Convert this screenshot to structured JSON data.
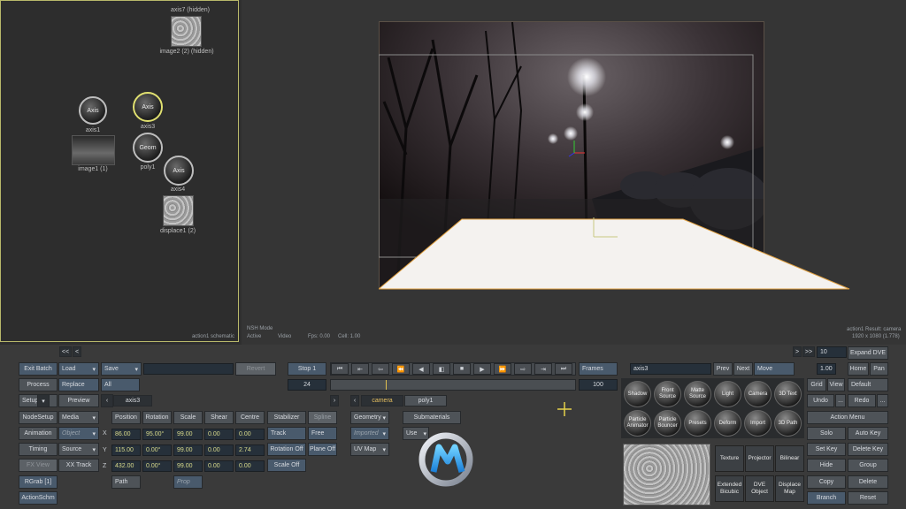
{
  "schematic": {
    "nodes": {
      "axis7_label": "axis7 (hidden)",
      "image2_label": "image2 (2) (hidden)",
      "axis1_ball": "Axis",
      "axis1_label": "axis1",
      "axis3_ball": "Axis",
      "axis3_label": "axis3",
      "image1_label": "image1 (1)",
      "geom_ball": "Geom",
      "poly1_label": "poly1",
      "axis4_ball": "Axis",
      "axis4_label": "axis4",
      "displace1_label": "displace1 (2)"
    },
    "status": "action1 schematic"
  },
  "viewport": {
    "info_top": "action1 Result: camera",
    "info_res": "1920 x 1080 (1.778)",
    "mode": "NSH Mode",
    "active": "Active",
    "video": "Video",
    "fps": "Fps: 0.00",
    "cell": "Cell: 1.00"
  },
  "toolbar": {
    "nav_left": "<<",
    "nav_left2": "<",
    "nav_right": ">",
    "nav_right2": ">>",
    "frame_field": "10",
    "expand": "Expand DVE",
    "scale_field": "1.00",
    "home": "Home",
    "pan": "Pan"
  },
  "left_buttons": {
    "exit": "Exit Batch",
    "load": "Load",
    "save": "Save",
    "revert": "Revert",
    "process": "Process",
    "replace": "Replace",
    "all": "All",
    "setup": "Setup",
    "preview": "Preview",
    "nodesetup": "NodeSetup",
    "media": "Media",
    "animation": "Animation",
    "object": "Object",
    "timing": "Timing",
    "source": "Source",
    "fx_view": "FX View",
    "xx_track": "XX Track",
    "rgrab": "RGrab [1]",
    "action_schm": "ActionSchm"
  },
  "transport": {
    "stop": "Stop 1",
    "frame": "24",
    "frames_label": "Frames",
    "end_frame": "100"
  },
  "tabs": {
    "axis_tab": "axis3",
    "camera_tab": "camera",
    "poly_tab": "poly1"
  },
  "transform": {
    "headers": [
      "Position",
      "Rotation",
      "Scale",
      "Shear",
      "Centre"
    ],
    "stabilizer": "Stabilizer",
    "spline": "Spline",
    "rows": [
      {
        "axis": "X",
        "pos": "86.00",
        "rot": "95.00°",
        "scale": "99.00",
        "shear": "0.00",
        "centre": "0.00"
      },
      {
        "axis": "Y",
        "pos": "115.00",
        "rot": "0.00°",
        "scale": "99.00",
        "shear": "0.00",
        "centre": "2.74"
      },
      {
        "axis": "Z",
        "pos": "432.00",
        "rot": "0.00°",
        "scale": "99.00",
        "shear": "0.00",
        "centre": "0.00"
      }
    ],
    "track": "Track",
    "free": "Free",
    "rotation_off": "Rotation Off",
    "plane_off": "Plane Off",
    "scale_off": "Scale Off",
    "path": "Path",
    "prop": "Prop"
  },
  "geometry": {
    "geometry": "Geometry",
    "imported": "Imported",
    "uv_map": "UV Map",
    "submaterials": "Submaterials",
    "use": "Use"
  },
  "object_panel": {
    "name": "axis3",
    "prev": "Prev",
    "next": "Next",
    "move": "Move"
  },
  "spheres": [
    "Shadow",
    "Front Source",
    "Matte Source",
    "Light",
    "Camera",
    "3D Text",
    "Particle Animator",
    "Particle Bouncer",
    "Presets",
    "Deform",
    "Import",
    "3D Path"
  ],
  "tiles": [
    "Texture",
    "Projector",
    "Bilinear",
    "Extended Bicubic",
    "DVE Object",
    "Displace Map"
  ],
  "right_menu": {
    "grid": "Grid",
    "view": "View",
    "default": "Default",
    "undo": "Undo",
    "redo": "Redo",
    "action_menu": "Action Menu",
    "solo": "Solo",
    "auto_key": "Auto Key",
    "set_key": "Set Key",
    "delete_key": "Delete Key",
    "hide": "Hide",
    "group": "Group",
    "copy": "Copy",
    "delete": "Delete",
    "branch": "Branch",
    "reset": "Reset",
    "more": "..."
  },
  "colors": {
    "accent_yellow": "#d7d98a",
    "button_bg": "#4e5358",
    "selection": "#e0e070"
  }
}
